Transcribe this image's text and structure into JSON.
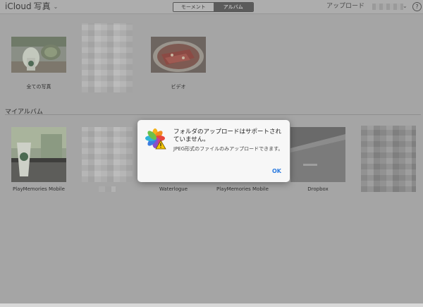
{
  "header": {
    "app_name": "iCloud",
    "section": "写真",
    "tabs": [
      {
        "label": "モーメント",
        "active": false
      },
      {
        "label": "アルバム",
        "active": true
      }
    ],
    "upload_label": "アップロード",
    "help_label": "?"
  },
  "top_albums": [
    {
      "caption": "全ての写真"
    },
    {
      "caption": ""
    },
    {
      "caption": "ビデオ"
    }
  ],
  "my_albums": {
    "title": "マイアルバム",
    "items": [
      {
        "caption": "PlayMemories Mobile"
      },
      {
        "caption": ""
      },
      {
        "caption": "Waterlogue"
      },
      {
        "caption": "PlayMemories Mobile"
      },
      {
        "caption": "Dropbox"
      },
      {
        "caption": ""
      }
    ]
  },
  "dialog": {
    "title": "フォルダのアップロードはサポートされていません。",
    "message": "JPEG形式のファイルのみアップロードできます。",
    "ok_label": "OK"
  }
}
